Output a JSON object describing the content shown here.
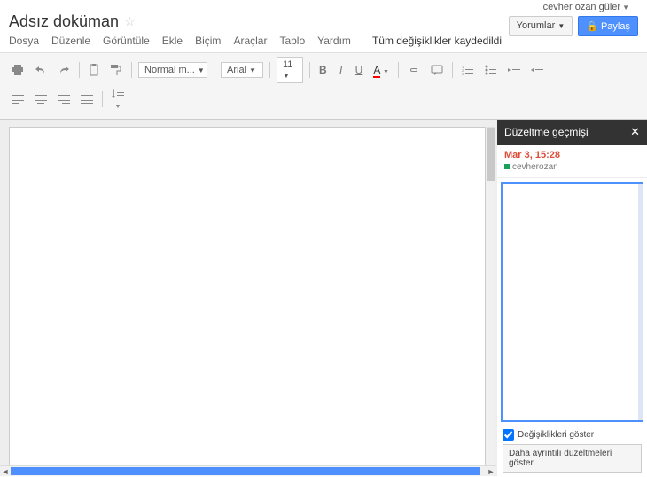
{
  "header": {
    "user": "cevher ozan güler",
    "title": "Adsız doküman",
    "comments": "Yorumlar",
    "share": "Paylaş"
  },
  "menu": {
    "file": "Dosya",
    "edit": "Düzenle",
    "view": "Görüntüle",
    "insert": "Ekle",
    "format": "Biçim",
    "tools": "Araçlar",
    "table": "Tablo",
    "help": "Yardım",
    "status": "Tüm değişiklikler kaydedildi"
  },
  "toolbar": {
    "style": "Normal m...",
    "font": "Arial",
    "size": "11",
    "textA": "A"
  },
  "panel": {
    "title": "Düzeltme geçmişi",
    "rev_date": "Mar 3, 15:28",
    "rev_user": "cevherozan",
    "show_changes": "Değişiklikleri göster",
    "detail": "Daha ayrıntılı düzeltmeleri göster"
  }
}
